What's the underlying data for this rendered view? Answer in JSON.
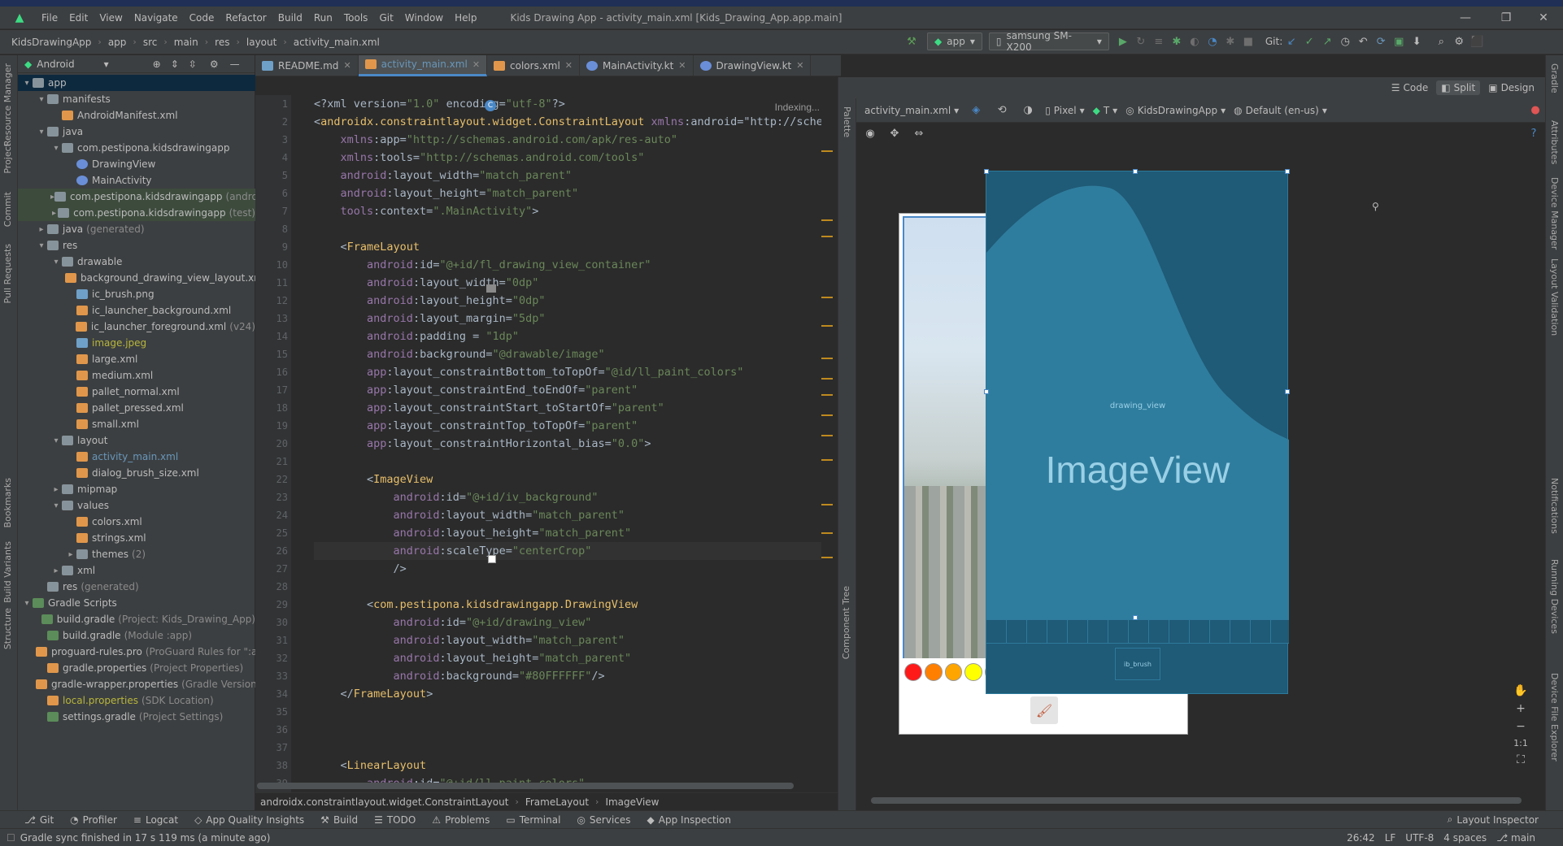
{
  "window": {
    "title": "Kids Drawing App - activity_main.xml [Kids_Drawing_App.app.main]"
  },
  "menu": [
    "File",
    "Edit",
    "View",
    "Navigate",
    "Code",
    "Refactor",
    "Build",
    "Run",
    "Tools",
    "Git",
    "Window",
    "Help"
  ],
  "breadcrumbs": [
    "KidsDrawingApp",
    "app",
    "src",
    "main",
    "res",
    "layout",
    "activity_main.xml"
  ],
  "toolbar": {
    "run_config": "app",
    "device": "samsung SM-X200",
    "git_label": "Git:"
  },
  "project_panel": {
    "view_selector": "Android",
    "tree": [
      {
        "label": "app",
        "indent": 0,
        "open": true,
        "icon": "folder",
        "selected": true
      },
      {
        "label": "manifests",
        "indent": 1,
        "open": true,
        "icon": "folder"
      },
      {
        "label": "AndroidManifest.xml",
        "indent": 2,
        "icon": "xml"
      },
      {
        "label": "java",
        "indent": 1,
        "open": true,
        "icon": "folder"
      },
      {
        "label": "com.pestipona.kidsdrawingapp",
        "indent": 2,
        "open": true,
        "icon": "folder"
      },
      {
        "label": "DrawingView",
        "indent": 3,
        "icon": "kt"
      },
      {
        "label": "MainActivity",
        "indent": 3,
        "icon": "kt"
      },
      {
        "label": "com.pestipona.kidsdrawingapp",
        "hint": "(androidTest)",
        "indent": 2,
        "closed": true,
        "icon": "folder",
        "hl": true
      },
      {
        "label": "com.pestipona.kidsdrawingapp",
        "hint": "(test)",
        "indent": 2,
        "closed": true,
        "icon": "folder",
        "hl": true
      },
      {
        "label": "java",
        "hint": "(generated)",
        "indent": 1,
        "closed": true,
        "icon": "folder"
      },
      {
        "label": "res",
        "indent": 1,
        "open": true,
        "icon": "folder"
      },
      {
        "label": "drawable",
        "indent": 2,
        "open": true,
        "icon": "folder"
      },
      {
        "label": "background_drawing_view_layout.xml",
        "indent": 3,
        "icon": "xml"
      },
      {
        "label": "ic_brush.png",
        "indent": 3,
        "icon": "img"
      },
      {
        "label": "ic_launcher_background.xml",
        "indent": 3,
        "icon": "xml"
      },
      {
        "label": "ic_launcher_foreground.xml",
        "hint": "(v24)",
        "indent": 3,
        "icon": "xml"
      },
      {
        "label": "image.jpeg",
        "indent": 3,
        "icon": "img",
        "color": "yellow"
      },
      {
        "label": "large.xml",
        "indent": 3,
        "icon": "xml"
      },
      {
        "label": "medium.xml",
        "indent": 3,
        "icon": "xml"
      },
      {
        "label": "pallet_normal.xml",
        "indent": 3,
        "icon": "xml"
      },
      {
        "label": "pallet_pressed.xml",
        "indent": 3,
        "icon": "xml"
      },
      {
        "label": "small.xml",
        "indent": 3,
        "icon": "xml"
      },
      {
        "label": "layout",
        "indent": 2,
        "open": true,
        "icon": "folder"
      },
      {
        "label": "activity_main.xml",
        "indent": 3,
        "icon": "xml",
        "color": "blue"
      },
      {
        "label": "dialog_brush_size.xml",
        "indent": 3,
        "icon": "xml"
      },
      {
        "label": "mipmap",
        "indent": 2,
        "closed": true,
        "icon": "folder"
      },
      {
        "label": "values",
        "indent": 2,
        "open": true,
        "icon": "folder"
      },
      {
        "label": "colors.xml",
        "indent": 3,
        "icon": "xml"
      },
      {
        "label": "strings.xml",
        "indent": 3,
        "icon": "xml"
      },
      {
        "label": "themes",
        "hint": "(2)",
        "indent": 3,
        "closed": true,
        "icon": "folder"
      },
      {
        "label": "xml",
        "indent": 2,
        "closed": true,
        "icon": "folder"
      },
      {
        "label": "res",
        "hint": "(generated)",
        "indent": 1,
        "icon": "folder"
      },
      {
        "label": "Gradle Scripts",
        "indent": 0,
        "open": true,
        "icon": "gradle"
      },
      {
        "label": "build.gradle",
        "hint": "(Project: Kids_Drawing_App)",
        "indent": 1,
        "icon": "gradle"
      },
      {
        "label": "build.gradle",
        "hint": "(Module :app)",
        "indent": 1,
        "icon": "gradle"
      },
      {
        "label": "proguard-rules.pro",
        "hint": "(ProGuard Rules for \":app\")",
        "indent": 1,
        "icon": "xml"
      },
      {
        "label": "gradle.properties",
        "hint": "(Project Properties)",
        "indent": 1,
        "icon": "xml"
      },
      {
        "label": "gradle-wrapper.properties",
        "hint": "(Gradle Version)",
        "indent": 1,
        "icon": "xml"
      },
      {
        "label": "local.properties",
        "hint": "(SDK Location)",
        "indent": 1,
        "icon": "xml",
        "color": "yellow"
      },
      {
        "label": "settings.gradle",
        "hint": "(Project Settings)",
        "indent": 1,
        "icon": "gradle"
      }
    ]
  },
  "left_tools": [
    "Resource Manager",
    "Project",
    "Commit",
    "Pull Requests",
    "Bookmarks",
    "Build Variants",
    "Structure"
  ],
  "right_tools": [
    "Gradle",
    "Attributes",
    "Device Manager",
    "Layout Validation",
    "Notifications",
    "Running Devices",
    "Device File Explorer"
  ],
  "tabs": [
    {
      "label": "README.md"
    },
    {
      "label": "activity_main.xml",
      "active": true
    },
    {
      "label": "colors.xml"
    },
    {
      "label": "MainActivity.kt"
    },
    {
      "label": "DrawingView.kt"
    }
  ],
  "editor": {
    "indexing": "Indexing...",
    "current_line": 26,
    "lines": [
      "<?xml version=\"1.0\" encoding=\"utf-8\"?>",
      "<androidx.constraintlayout.widget.ConstraintLayout xmlns:android=\"http://schemas",
      "    xmlns:app=\"http://schemas.android.com/apk/res-auto\"",
      "    xmlns:tools=\"http://schemas.android.com/tools\"",
      "    android:layout_width=\"match_parent\"",
      "    android:layout_height=\"match_parent\"",
      "    tools:context=\".MainActivity\">",
      "",
      "    <FrameLayout",
      "        android:id=\"@+id/fl_drawing_view_container\"",
      "        android:layout_width=\"0dp\"",
      "        android:layout_height=\"0dp\"",
      "        android:layout_margin=\"5dp\"",
      "        android:padding = \"1dp\"",
      "        android:background=\"@drawable/image\"",
      "        app:layout_constraintBottom_toTopOf=\"@id/ll_paint_colors\"",
      "        app:layout_constraintEnd_toEndOf=\"parent\"",
      "        app:layout_constraintStart_toStartOf=\"parent\"",
      "        app:layout_constraintTop_toTopOf=\"parent\"",
      "        app:layout_constraintHorizontal_bias=\"0.0\">",
      "",
      "        <ImageView",
      "            android:id=\"@+id/iv_background\"",
      "            android:layout_width=\"match_parent\"",
      "            android:layout_height=\"match_parent\"",
      "            android:scaleType=\"centerCrop\"",
      "            />",
      "",
      "        <com.pestipona.kidsdrawingapp.DrawingView",
      "            android:id=\"@+id/drawing_view\"",
      "            android:layout_width=\"match_parent\"",
      "            android:layout_height=\"match_parent\"",
      "            android:background=\"#80FFFFFF\"/>",
      "    </FrameLayout>",
      "",
      "",
      "",
      "    <LinearLayout",
      "        android:id=\"@+id/ll_paint_colors\""
    ]
  },
  "editor_breadcrumb": [
    "androidx.constraintlayout.widget.ConstraintLayout",
    "FrameLayout",
    "ImageView"
  ],
  "design": {
    "view_modes": [
      "Code",
      "Split",
      "Design"
    ],
    "active_mode": "Split",
    "palette_label": "Palette",
    "component_tree_label": "Component Tree",
    "file_dropdown": "activity_main.xml",
    "device_dropdown": "Pixel",
    "api_dropdown": "T",
    "theme_dropdown": "KidsDrawingApp",
    "locale_dropdown": "Default (en-us)",
    "blueprint_drawing_label": "drawing_view",
    "blueprint_image_label": "ImageView",
    "blueprint_brush_label": "ib_brush",
    "zoom_fit_label": "1:1",
    "swatch_colors": [
      "#ff1a1a",
      "#ff7f00",
      "#ffa500",
      "#ffff00",
      "#ffc299",
      "#00ff00",
      "#00ffcc",
      "#00aaff",
      "#0000ff",
      "#7f00ff",
      "#ff00ff",
      "#555555",
      "#000000",
      "#ffffff"
    ]
  },
  "bottom_tools": [
    "Git",
    "Profiler",
    "Logcat",
    "App Quality Insights",
    "Build",
    "TODO",
    "Problems",
    "Terminal",
    "Services",
    "App Inspection"
  ],
  "layout_inspector": "Layout Inspector",
  "status": {
    "message": "Gradle sync finished in 17 s 119 ms (a minute ago)",
    "position": "26:42",
    "line_sep": "LF",
    "encoding": "UTF-8",
    "indent": "4 spaces",
    "branch": "main"
  }
}
